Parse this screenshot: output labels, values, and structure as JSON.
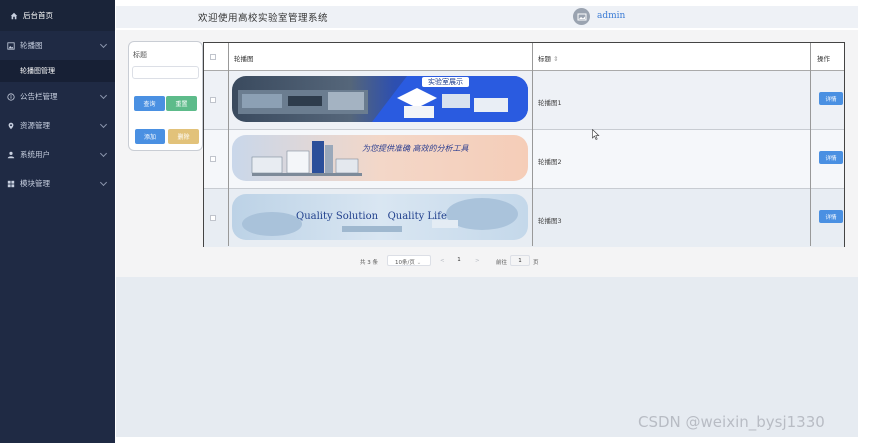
{
  "sidebar": {
    "home_label": "后台首页",
    "items": [
      {
        "label": "轮播图",
        "icon": "image-icon"
      },
      {
        "label": "轮播图管理",
        "icon": ""
      },
      {
        "label": "公告栏管理",
        "icon": "info-circle-icon"
      },
      {
        "label": "资源管理",
        "icon": "location-pin-icon"
      },
      {
        "label": "系统用户",
        "icon": "user-icon"
      },
      {
        "label": "模块管理",
        "icon": "grid-icon"
      }
    ]
  },
  "header": {
    "system_title": "欢迎使用高校实验室管理系统",
    "username": "admin"
  },
  "search": {
    "label": "标题",
    "input_value": "",
    "query_label": "查询",
    "reset_label": "重置",
    "add_label": "添加",
    "delete_label": "删除"
  },
  "table": {
    "columns": [
      "轮播图",
      "标题",
      "操作"
    ],
    "sort_indicator": "⇕",
    "rows": [
      {
        "title": "轮播图1",
        "action": "详情",
        "banner_text": "实验室展示"
      },
      {
        "title": "轮播图2",
        "action": "详情",
        "banner_text": "为您提供准确 高效的分析工具"
      },
      {
        "title": "轮播图3",
        "action": "详情",
        "banner_text": "Quality Solution   Quality Life"
      }
    ]
  },
  "pagination": {
    "total_text": "共 3 条",
    "page_size": "10条/页",
    "prev": "<",
    "current_page": "1",
    "next": ">",
    "goto_label": "前往",
    "goto_value": "1",
    "page_suffix": "页"
  },
  "watermark": "CSDN @weixin_bysj1330",
  "colors": {
    "sidebar_bg": "#1f2a44",
    "primary": "#4a90e2",
    "success": "#5dbb8a",
    "warning": "#e2c27a"
  }
}
